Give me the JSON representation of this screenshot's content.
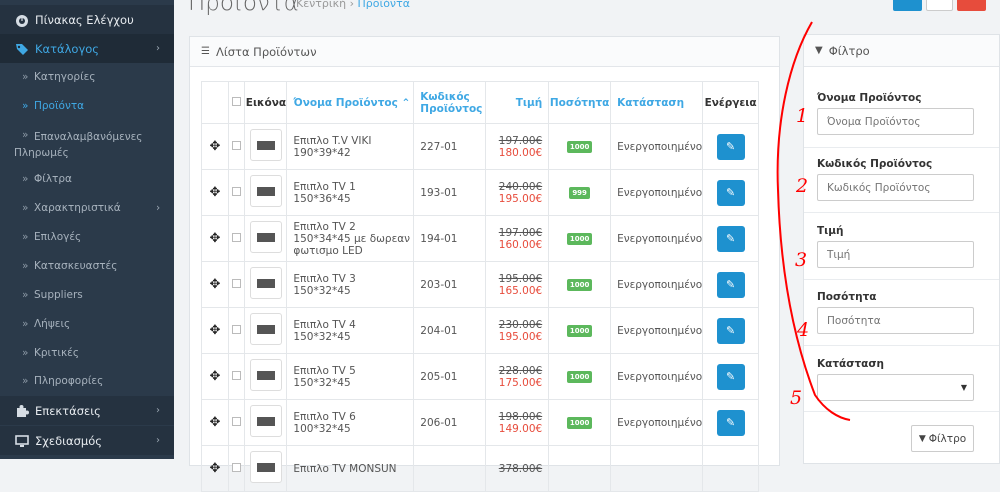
{
  "sidebar": {
    "top_items": [
      {
        "label": "Πίνακας Ελέγχου",
        "icon": "dashboard-icon"
      },
      {
        "label": "Κατάλογος",
        "icon": "tag-icon"
      }
    ],
    "sub_items": [
      {
        "label": "Κατηγορίες"
      },
      {
        "label": "Προϊόντα"
      },
      {
        "label": "Επαναλαμβανόμενες Πληρωμές"
      },
      {
        "label": "Φίλτρα"
      },
      {
        "label": "Χαρακτηριστικά"
      },
      {
        "label": "Επιλογές"
      },
      {
        "label": "Κατασκευαστές"
      },
      {
        "label": "Suppliers"
      },
      {
        "label": "Λήψεις"
      },
      {
        "label": "Κριτικές"
      },
      {
        "label": "Πληροφορίες"
      }
    ],
    "bottom_items": [
      {
        "label": "Επεκτάσεις",
        "icon": "puzzle-icon"
      },
      {
        "label": "Σχεδιασμός",
        "icon": "monitor-icon"
      }
    ]
  },
  "header": {
    "title": "Προϊόντα",
    "breadcrumb_home": "Κεντρική",
    "breadcrumb_sep": "›",
    "breadcrumb_current": "Προϊόντα"
  },
  "list_panel": {
    "title": "Λίστα Προϊόντων",
    "columns": {
      "image": "Εικόνα",
      "name": "Όνομα Προϊόντος",
      "code": "Κωδικός Προϊόντος",
      "price": "Τιμή",
      "qty": "Ποσότητα",
      "status": "Κατάσταση",
      "actions": "Ενέργεια"
    },
    "rows": [
      {
        "name": "Επιπλο T.V VIKI 190*39*42",
        "code": "227-01",
        "old_price": "197.00€",
        "price": "180.00€",
        "qty": "1000",
        "status": "Ενεργοποιημένο"
      },
      {
        "name": "Επιπλο TV 1 150*36*45",
        "code": "193-01",
        "old_price": "240.00€",
        "price": "195.00€",
        "qty": "999",
        "status": "Ενεργοποιημένο"
      },
      {
        "name": "Επιπλο TV 2 150*34*45 με δωρεαν φωτισμο LED",
        "code": "194-01",
        "old_price": "197.00€",
        "price": "160.00€",
        "qty": "1000",
        "status": "Ενεργοποιημένο"
      },
      {
        "name": "Επιπλο TV 3 150*32*45",
        "code": "203-01",
        "old_price": "195.00€",
        "price": "165.00€",
        "qty": "1000",
        "status": "Ενεργοποιημένο"
      },
      {
        "name": "Επιπλο TV 4 150*32*45",
        "code": "204-01",
        "old_price": "230.00€",
        "price": "195.00€",
        "qty": "1000",
        "status": "Ενεργοποιημένο"
      },
      {
        "name": "Επιπλο TV 5 150*32*45",
        "code": "205-01",
        "old_price": "228.00€",
        "price": "175.00€",
        "qty": "1000",
        "status": "Ενεργοποιημένο"
      },
      {
        "name": "Επιπλο TV 6 100*32*45",
        "code": "206-01",
        "old_price": "198.00€",
        "price": "149.00€",
        "qty": "1000",
        "status": "Ενεργοποιημένο"
      },
      {
        "name": "Επιπλο TV MONSUN",
        "code": "",
        "old_price": "378.00€",
        "price": "",
        "qty": "",
        "status": ""
      }
    ]
  },
  "filter_panel": {
    "title": "Φίλτρο",
    "fields": [
      {
        "label": "Όνομα Προϊόντος",
        "placeholder": "Όνομα Προϊόντος"
      },
      {
        "label": "Κωδικός Προϊόντος",
        "placeholder": "Κωδικός Προϊόντος"
      },
      {
        "label": "Τιμή",
        "placeholder": "Τιμή"
      },
      {
        "label": "Ποσότητα",
        "placeholder": "Ποσότητα"
      }
    ],
    "status_label": "Κατάσταση",
    "status_value": "",
    "button_label": "Φίλτρο"
  },
  "annotations": [
    "1",
    "2",
    "3",
    "4",
    "5"
  ],
  "colors": {
    "sidebar": "#2b3a4a",
    "accent": "#1e91cf",
    "link": "#3fa8e4",
    "badge": "#5cb85c",
    "sale": "#e74c3c",
    "annotation": "#ff0000"
  }
}
